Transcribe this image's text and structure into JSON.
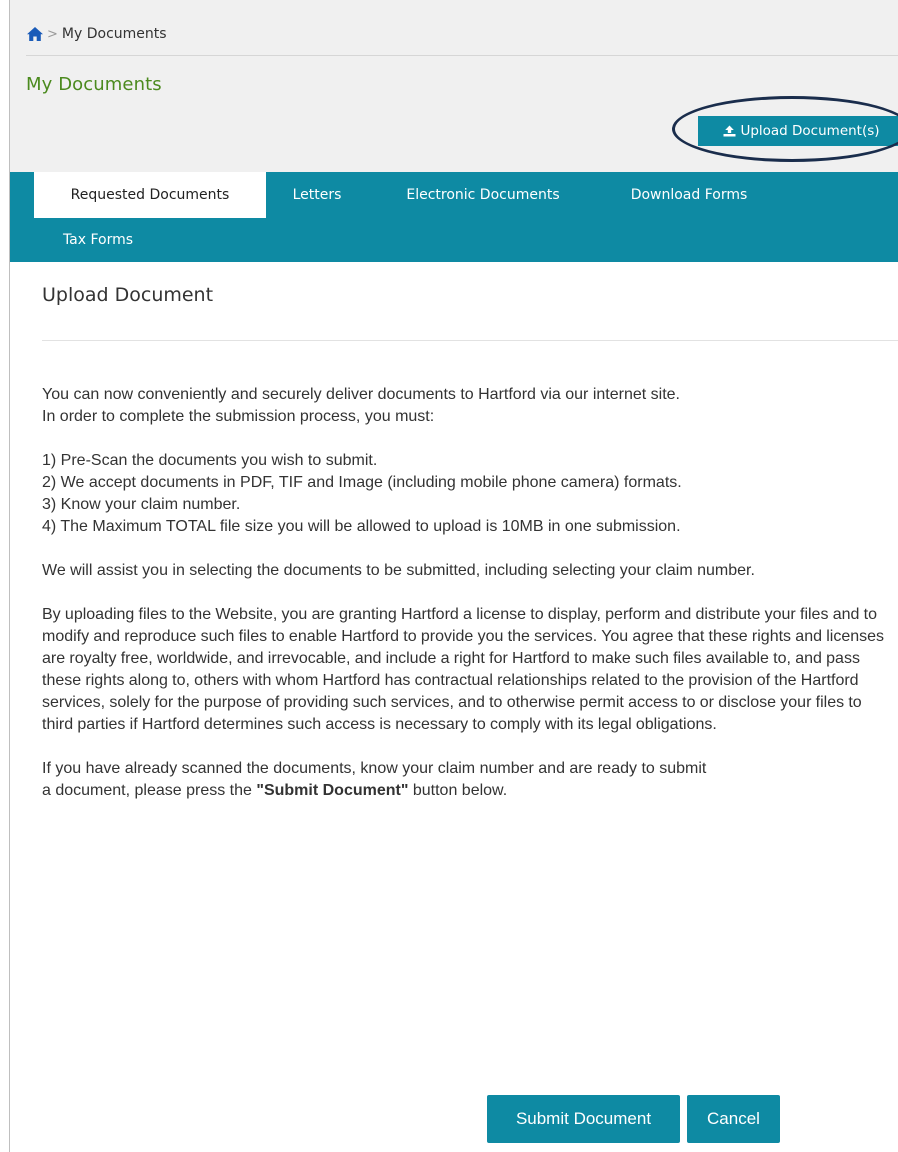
{
  "breadcrumb": {
    "home_icon": "home-icon",
    "separator": ">",
    "current": "My Documents"
  },
  "page_title": "My Documents",
  "upload_button": {
    "icon": "upload-icon",
    "label": "Upload Document(s)"
  },
  "tabs": [
    {
      "label": "Requested Documents",
      "active": true
    },
    {
      "label": "Letters",
      "active": false
    },
    {
      "label": "Electronic Documents",
      "active": false
    },
    {
      "label": "Download Forms",
      "active": false
    },
    {
      "label": "Tax Forms",
      "active": false
    }
  ],
  "modal": {
    "title": "Upload Document",
    "intro_line_1": "You can now conveniently and securely deliver documents to Hartford via our internet site.",
    "intro_line_2": "In order to complete the submission process, you must:",
    "steps": [
      "1) Pre-Scan the documents you wish to submit.",
      "2) We accept documents in PDF, TIF and Image (including mobile phone camera) formats.",
      "3) Know your claim number.",
      "4) The Maximum TOTAL file size you will be allowed to upload is 10MB in one submission."
    ],
    "assist": "We will assist you in selecting the documents to be submitted, including selecting your claim number.",
    "license": "By uploading files to the Website, you are granting Hartford a license to display, perform and distribute your files and to modify and reproduce such files to enable Hartford to provide you the services. You agree that these rights and licenses are royalty free, worldwide, and irrevocable, and include a right for Hartford to make such files available to, and pass these rights along to, others with whom Hartford has contractual relationships related to the provision of the Hartford services, solely for the purpose of providing such services, and to otherwise permit access to or disclose your files to third parties if Hartford determines such access is necessary to comply with its legal obligations.",
    "ready_line_1": "If you have already scanned the documents, know your claim number and are ready to submit",
    "ready_line_2_prefix": "a document, please press the ",
    "ready_line_2_bold": "\"Submit Document\"",
    "ready_line_2_suffix": " button below.",
    "submit_label": "Submit Document",
    "cancel_label": "Cancel"
  },
  "colors": {
    "teal": "#0e8aa3",
    "title_green": "#4b8a1e",
    "home_blue": "#1a5bb8",
    "highlight_ring": "#1a2d4c"
  }
}
